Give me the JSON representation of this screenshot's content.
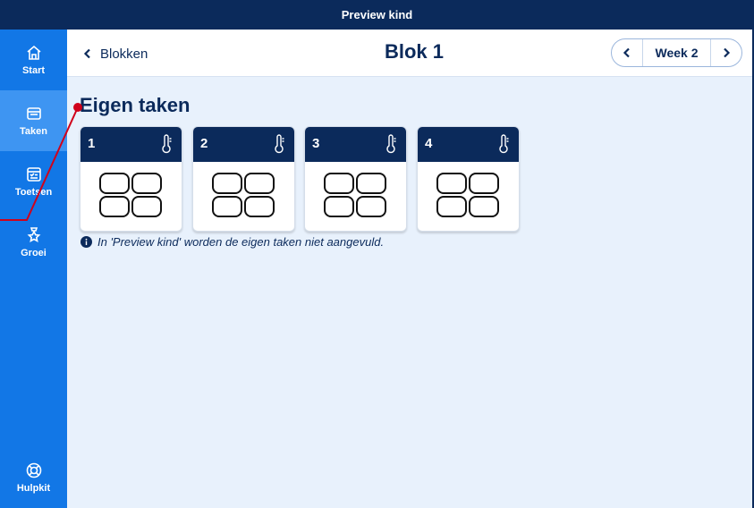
{
  "app": {
    "preview_title": "Preview kind"
  },
  "sidebar": {
    "items": [
      {
        "label": "Start",
        "icon": "home-icon",
        "active": false
      },
      {
        "label": "Taken",
        "icon": "tasks-icon",
        "active": true
      },
      {
        "label": "Toetsen",
        "icon": "tests-icon",
        "active": false
      },
      {
        "label": "Groei",
        "icon": "award-icon",
        "active": false
      }
    ],
    "help": {
      "label": "Hulpkit",
      "icon": "lifebuoy-icon"
    }
  },
  "header": {
    "back_label": "Blokken",
    "title": "Blok 1",
    "week_label": "Week 2"
  },
  "main": {
    "section_title": "Eigen taken",
    "cards": [
      {
        "number": "1"
      },
      {
        "number": "2"
      },
      {
        "number": "3"
      },
      {
        "number": "4"
      }
    ],
    "note": "In 'Preview kind' worden de eigen taken niet aangevuld."
  },
  "colors": {
    "navy": "#0b2a5b",
    "sidebar_blue": "#1277e6",
    "sidebar_active": "#3e95f2",
    "background": "#e8f1fc",
    "annotation_red": "#d0021b"
  }
}
